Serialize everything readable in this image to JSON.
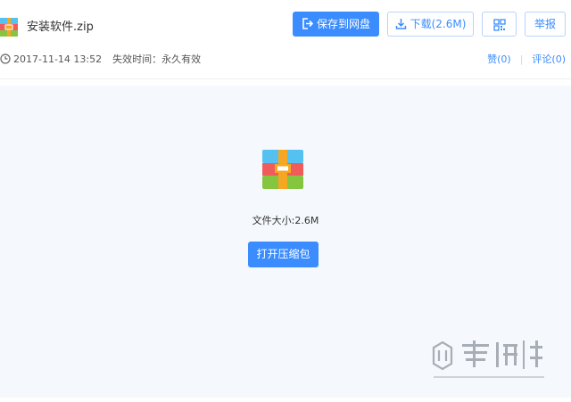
{
  "file": {
    "name": "安装软件.zip"
  },
  "toolbar": {
    "save_label": "保存到网盘",
    "download_label": "下载(2.6M)",
    "qr_icon": "qr-code-icon",
    "report_label": "举报"
  },
  "meta": {
    "date": "2017-11-14 13:52",
    "expiry": "失效时间：永久有效",
    "likes": "赞(0)",
    "comments": "评论(0)"
  },
  "preview": {
    "size_text": "文件大小:2.6M",
    "open_label": "打开压缩包"
  },
  "colors": {
    "accent": "#3b8cff",
    "panel_bg": "#f5f8fc"
  }
}
